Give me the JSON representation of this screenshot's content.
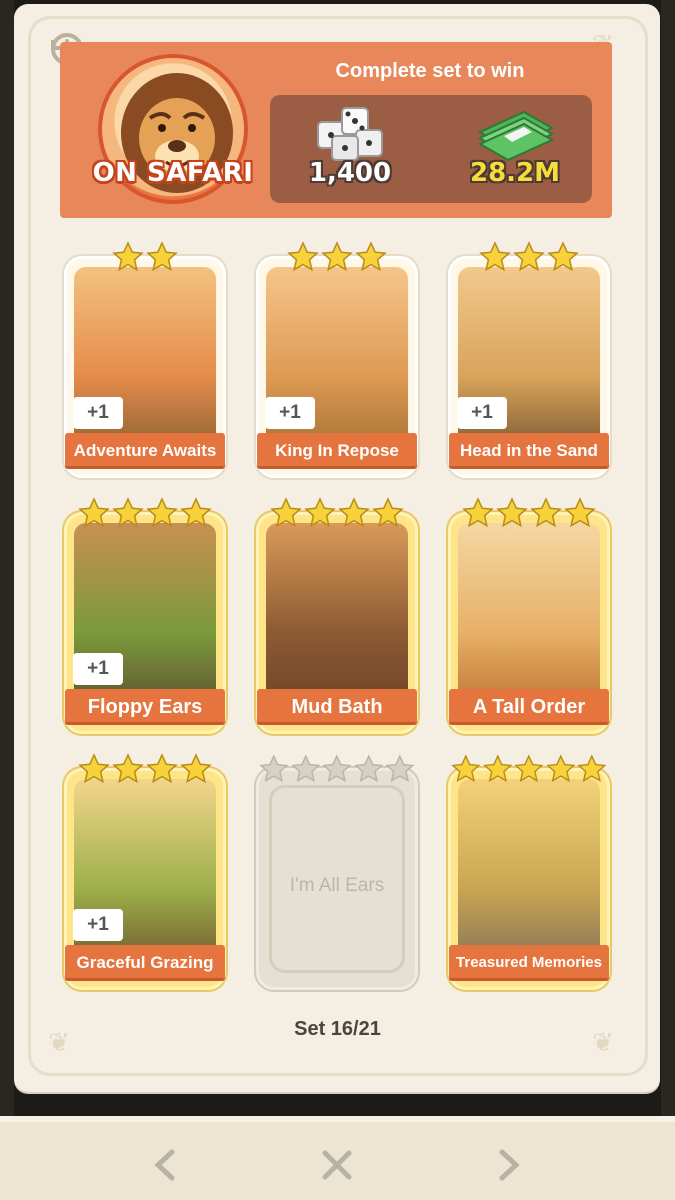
{
  "header": {
    "set_name": "ON SAFARI",
    "reward_title": "Complete set to win",
    "dice_reward": "1,400",
    "cash_reward": "28.2M"
  },
  "cards": [
    {
      "title": "Adventure Awaits",
      "stars": 2,
      "extra": "+1",
      "collected": true
    },
    {
      "title": "King In Repose",
      "stars": 3,
      "extra": "+1",
      "collected": true
    },
    {
      "title": "Head in the Sand",
      "stars": 3,
      "extra": "+1",
      "collected": true
    },
    {
      "title": "Floppy Ears",
      "stars": 4,
      "extra": "+1",
      "collected": true
    },
    {
      "title": "Mud Bath",
      "stars": 4,
      "extra": "",
      "collected": true
    },
    {
      "title": "A Tall Order",
      "stars": 4,
      "extra": "",
      "collected": true
    },
    {
      "title": "Graceful Grazing",
      "stars": 4,
      "extra": "+1",
      "collected": true
    },
    {
      "title": "I'm All Ears",
      "stars": 5,
      "extra": "",
      "collected": false
    },
    {
      "title": "Treasured Memories",
      "stars": 5,
      "extra": "",
      "collected": true
    }
  ],
  "progress": "Set 16/21",
  "nav": {
    "prev": "<",
    "close": "X",
    "next": ">"
  },
  "colors": {
    "banner": "#e7875a",
    "label": "#e5743f",
    "star": "#f7d23b"
  }
}
